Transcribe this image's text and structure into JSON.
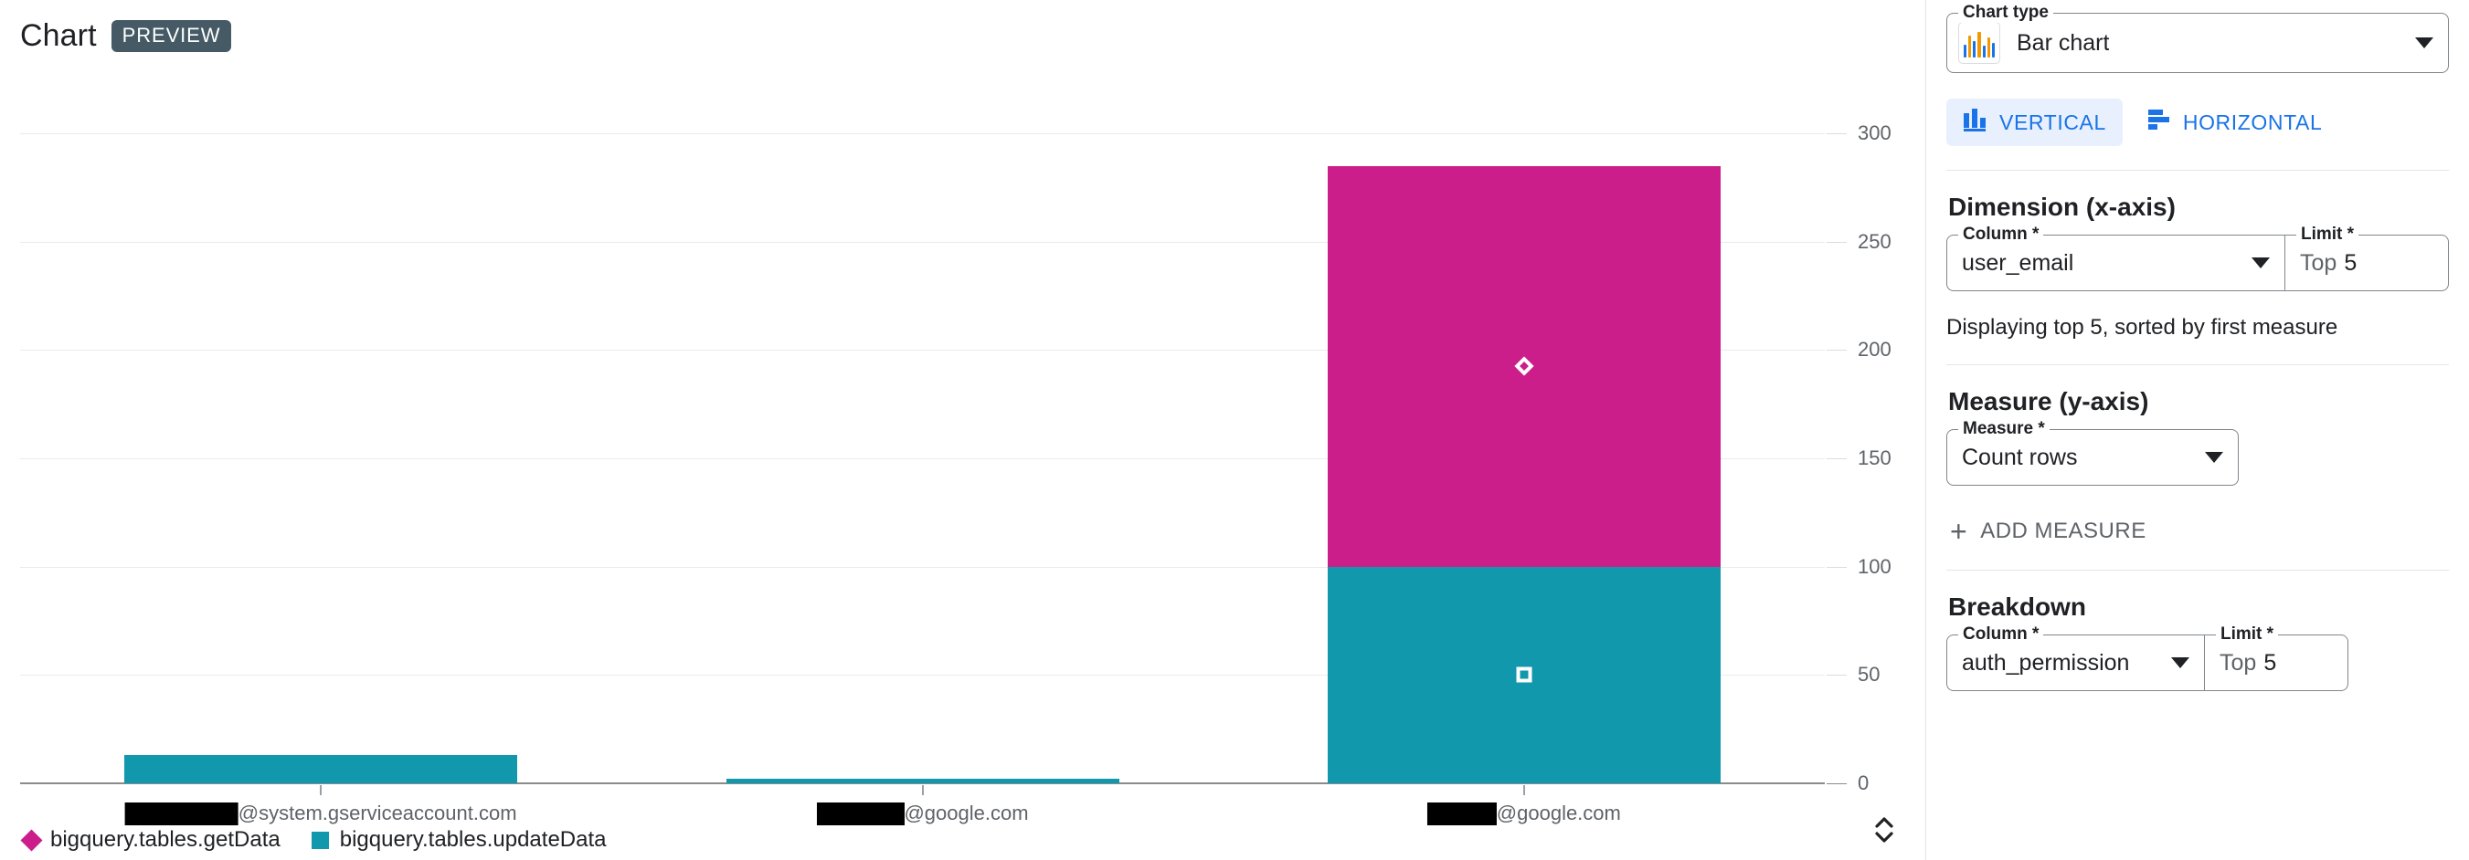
{
  "chart_panel": {
    "title": "Chart",
    "preview_badge": "PREVIEW",
    "resize_handle_name": "vertical-resize-handle"
  },
  "chart_data": {
    "type": "bar",
    "subtype": "stacked-vertical",
    "title": "Chart",
    "xlabel": "",
    "ylabel": "",
    "ylim": [
      0,
      300
    ],
    "yticks": [
      0,
      50,
      100,
      150,
      200,
      250,
      300
    ],
    "grid": true,
    "legend_position": "bottom-left",
    "categories": [
      "██████████@system.gserviceaccount.com",
      "█████@google.com",
      "████@google.com"
    ],
    "category_labels": [
      {
        "redacted": true,
        "redact_width": 124,
        "suffix": "@system.gserviceaccount.com"
      },
      {
        "redacted": true,
        "redact_width": 96,
        "suffix": "@google.com"
      },
      {
        "redacted": true,
        "redact_width": 76,
        "suffix": "@google.com"
      }
    ],
    "series": [
      {
        "name": "bigquery.tables.getData",
        "color": "#CC1E8B",
        "marker": "diamond",
        "values": [
          0,
          0,
          185
        ]
      },
      {
        "name": "bigquery.tables.updateData",
        "color": "#1298AC",
        "marker": "square",
        "values": [
          13,
          2,
          100
        ]
      }
    ],
    "totals": [
      13,
      2,
      285
    ]
  },
  "settings": {
    "chart_type": {
      "legend": "Chart type",
      "value": "Bar chart",
      "icon": "bar-chart-icon"
    },
    "orientation": {
      "vertical_label": "VERTICAL",
      "horizontal_label": "HORIZONTAL",
      "selected": "VERTICAL"
    },
    "dimension": {
      "heading": "Dimension (x-axis)",
      "column_legend": "Column *",
      "column_value": "user_email",
      "limit_legend": "Limit *",
      "limit_prefix": "Top",
      "limit_value": "5",
      "helper": "Displaying top 5, sorted by first measure"
    },
    "measure": {
      "heading": "Measure (y-axis)",
      "measure_legend": "Measure *",
      "measure_value": "Count rows",
      "add_measure_label": "ADD MEASURE"
    },
    "breakdown": {
      "heading": "Breakdown",
      "column_legend": "Column *",
      "column_value": "auth_permission",
      "limit_legend": "Limit *",
      "limit_prefix": "Top",
      "limit_value": "5"
    }
  },
  "colors": {
    "series_magenta": "#CC1E8B",
    "series_teal": "#1298AC",
    "accent_blue": "#1a73e8",
    "accent_blue_bg": "#e8f0fe",
    "badge_slate": "#455a64",
    "grid": "#ebebeb",
    "axis": "#8b8b8b",
    "text_primary": "#202124",
    "text_secondary": "#5f6368"
  }
}
